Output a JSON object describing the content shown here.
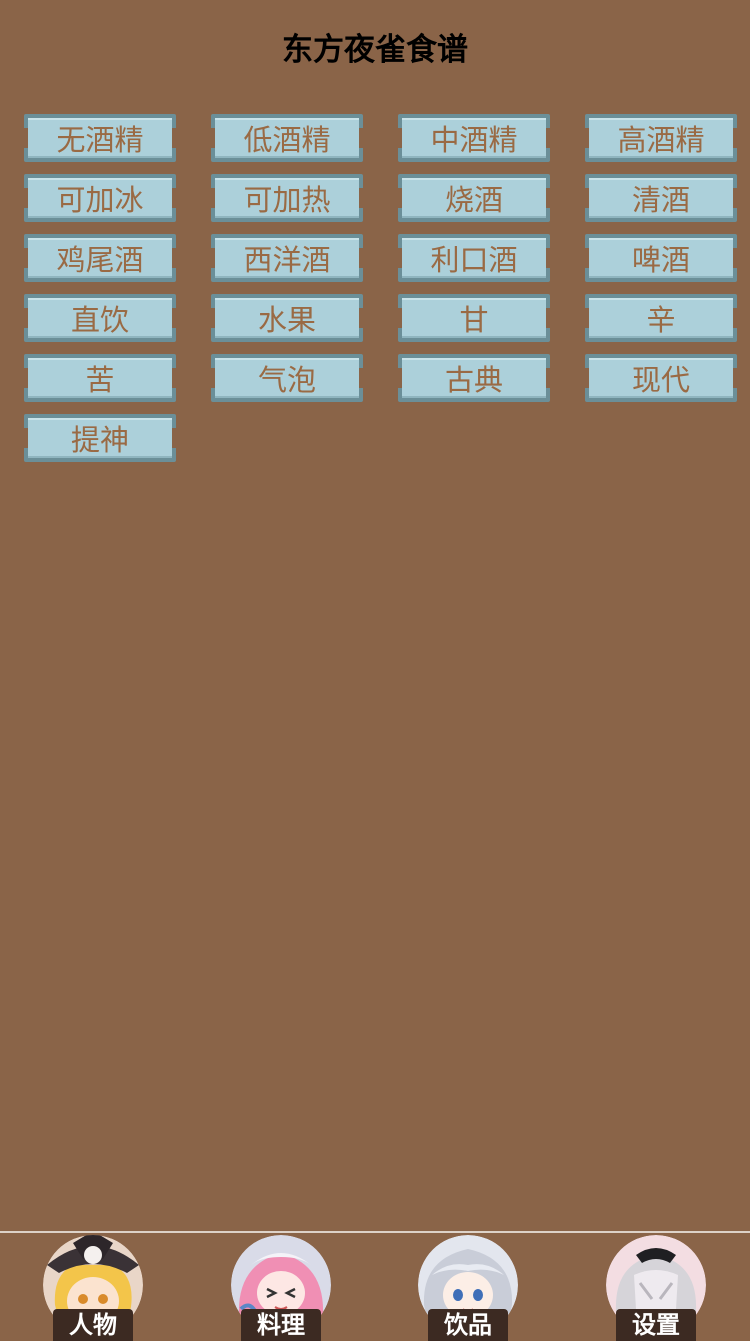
{
  "header": {
    "title": "东方夜雀食谱"
  },
  "tags": [
    "无酒精",
    "低酒精",
    "中酒精",
    "高酒精",
    "可加冰",
    "可加热",
    "烧酒",
    "清酒",
    "鸡尾酒",
    "西洋酒",
    "利口酒",
    "啤酒",
    "直饮",
    "水果",
    "甘",
    "辛",
    "苦",
    "气泡",
    "古典",
    "现代",
    "提神"
  ],
  "nav": {
    "items": [
      {
        "label": "人物",
        "icon": "marisa-avatar-icon"
      },
      {
        "label": "料理",
        "icon": "yuyuko-avatar-icon"
      },
      {
        "label": "饮品",
        "icon": "sakuya-avatar-icon"
      },
      {
        "label": "设置",
        "icon": "youmu-avatar-icon"
      }
    ]
  },
  "colors": {
    "background": "#8a6448",
    "tag_fill": "#acd0da",
    "tag_border": "#6b8f98",
    "tag_text": "#9a6a44",
    "nav_label_bg": "#3c2a22"
  }
}
